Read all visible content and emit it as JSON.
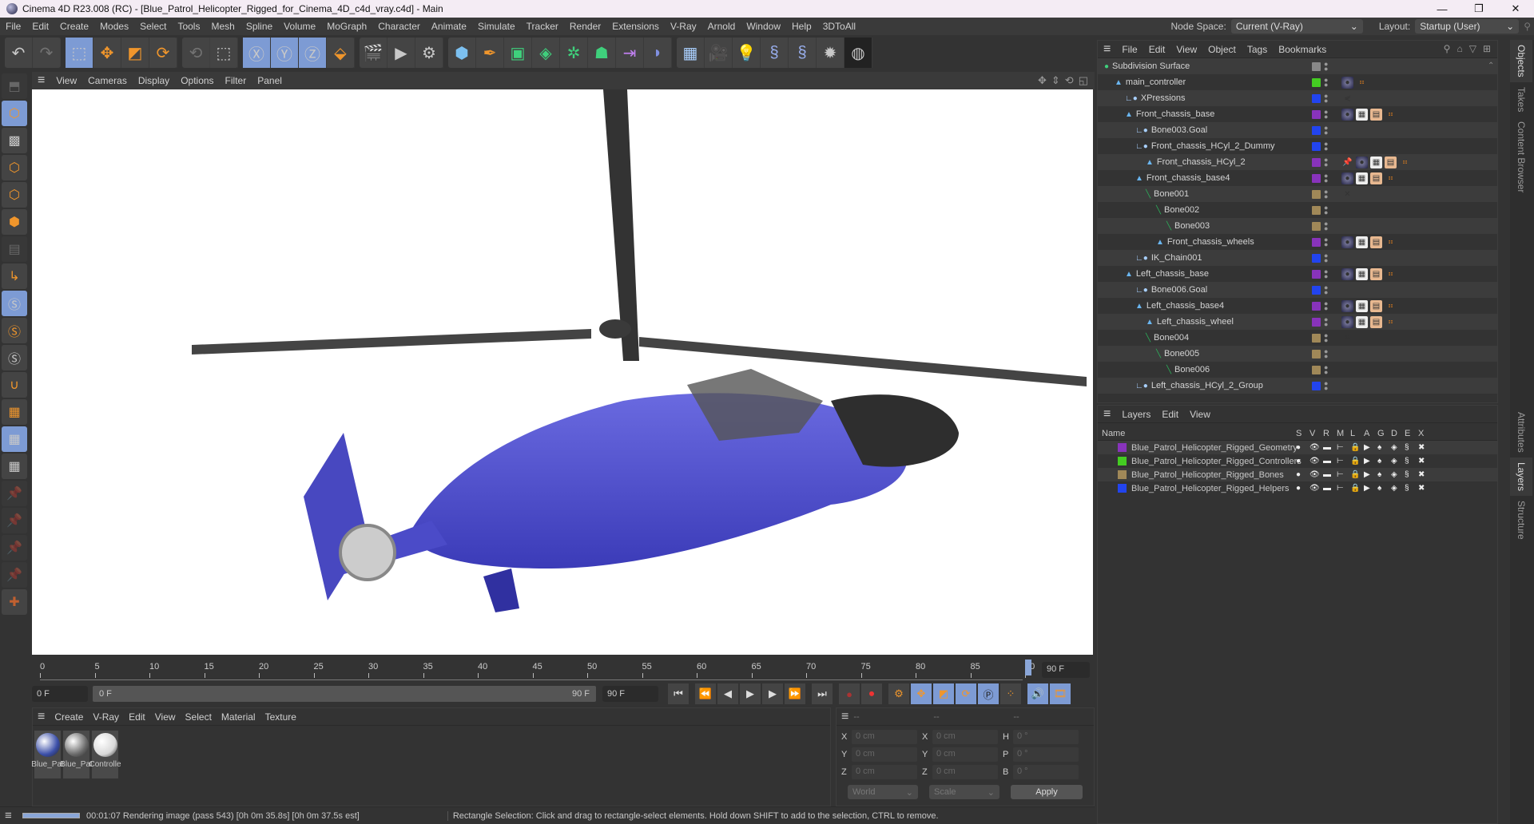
{
  "window": {
    "title": "Cinema 4D R23.008 (RC) - [Blue_Patrol_Helicopter_Rigged_for_Cinema_4D_c4d_vray.c4d] - Main",
    "controls": [
      "minimize",
      "restore",
      "close"
    ]
  },
  "menubar": {
    "items": [
      "File",
      "Edit",
      "Create",
      "Modes",
      "Select",
      "Tools",
      "Mesh",
      "Spline",
      "Volume",
      "MoGraph",
      "Character",
      "Animate",
      "Simulate",
      "Tracker",
      "Render",
      "Extensions",
      "V-Ray",
      "Arnold",
      "Window",
      "Help",
      "3DToAll"
    ],
    "node_space_label": "Node Space:",
    "node_space_value": "Current (V-Ray)",
    "layout_label": "Layout:",
    "layout_value": "Startup (User)"
  },
  "toolbar": {
    "groups": [
      [
        "undo-icon",
        "redo-icon"
      ],
      [
        "live-selection-icon",
        "move-icon",
        "scale-icon",
        "rotate-icon"
      ],
      [
        "psr-icon",
        "rect-selection-icon"
      ],
      [
        "x-axis-icon",
        "y-axis-icon",
        "z-axis-icon",
        "coord-system-icon"
      ],
      [
        "render-view-icon",
        "render-icon",
        "render-settings-icon"
      ],
      [
        "cube-icon",
        "pen-icon",
        "subdivision-icon",
        "extrude-icon",
        "cloner-icon",
        "voronoi-icon",
        "symmetry-icon",
        "deformer-icon"
      ],
      [
        "floor-icon",
        "camera-icon",
        "light-icon",
        "python-icon",
        "python2-icon",
        "gear-burst-icon",
        "sphere-wire-icon"
      ]
    ]
  },
  "viewport": {
    "menu": [
      "View",
      "Cameras",
      "Display",
      "Options",
      "Filter",
      "Panel"
    ]
  },
  "timeline": {
    "ticks": [
      "0",
      "5",
      "10",
      "15",
      "20",
      "25",
      "30",
      "35",
      "40",
      "45",
      "50",
      "55",
      "60",
      "65",
      "70",
      "75",
      "80",
      "85",
      "90"
    ],
    "end_frame": "90 F",
    "current_frame": "0 F",
    "range_start": "0 F",
    "range_end": "90 F",
    "max_frame": "90 F"
  },
  "material_panel": {
    "menu": [
      "Create",
      "V-Ray",
      "Edit",
      "View",
      "Select",
      "Material",
      "Texture"
    ],
    "materials": [
      {
        "name": "Blue_Pat",
        "color": "#3a4ea8"
      },
      {
        "name": "Blue_Pat",
        "color": "#6a6a6a"
      },
      {
        "name": "Controlle",
        "color": "#d8d8d8"
      }
    ]
  },
  "coordinates": {
    "headers": [
      "--",
      "--",
      "--"
    ],
    "rows": [
      {
        "a": "X",
        "av": "0 cm",
        "b": "X",
        "bv": "0 cm",
        "c": "H",
        "cv": "0 °"
      },
      {
        "a": "Y",
        "av": "0 cm",
        "b": "Y",
        "bv": "0 cm",
        "c": "P",
        "cv": "0 °"
      },
      {
        "a": "Z",
        "av": "0 cm",
        "b": "Z",
        "bv": "0 cm",
        "c": "B",
        "cv": "0 °"
      }
    ],
    "mode": "World",
    "transform": "Scale",
    "apply": "Apply"
  },
  "status": {
    "render": "00:01:07 Rendering image (pass 543) [0h  0m 35.8s] [0h  0m 37.5s est]",
    "progress": 1.0,
    "hint": "Rectangle Selection: Click and drag to rectangle-select elements. Hold down SHIFT to add to the selection, CTRL to remove."
  },
  "objects": {
    "menu": [
      "File",
      "Edit",
      "View",
      "Object",
      "Tags",
      "Bookmarks"
    ],
    "rows": [
      {
        "name": "Subdivision Surface",
        "depth": 0,
        "type": "subdiv",
        "color": "#888888",
        "tags": []
      },
      {
        "name": "main_controller",
        "depth": 1,
        "type": "null",
        "color": "#44cc22",
        "tags": [
          "material",
          "vray"
        ]
      },
      {
        "name": "XPressions",
        "depth": 2,
        "type": "helper",
        "color": "#2244ee",
        "tags": [
          "xpresso"
        ]
      },
      {
        "name": "Front_chassis_base",
        "depth": 2,
        "type": "null",
        "color": "#8833bb",
        "tags": [
          "material",
          "uv",
          "texture",
          "vray"
        ]
      },
      {
        "name": "Bone003.Goal",
        "depth": 3,
        "type": "helper",
        "color": "#2244ee",
        "tags": []
      },
      {
        "name": "Front_chassis_HCyl_2_Dummy",
        "depth": 3,
        "type": "helper",
        "color": "#2244ee",
        "tags": []
      },
      {
        "name": "Front_chassis_HCyl_2",
        "depth": 4,
        "type": "null",
        "color": "#8833bb",
        "tags": [
          "constraint",
          "material",
          "uv",
          "texture",
          "vray"
        ]
      },
      {
        "name": "Front_chassis_base4",
        "depth": 3,
        "type": "null",
        "color": "#8833bb",
        "tags": [
          "material",
          "uv",
          "texture",
          "vray"
        ]
      },
      {
        "name": "Bone001",
        "depth": 4,
        "type": "bone",
        "color": "#a08858",
        "tags": [
          "ik"
        ]
      },
      {
        "name": "Bone002",
        "depth": 5,
        "type": "bone",
        "color": "#a08858",
        "tags": []
      },
      {
        "name": "Bone003",
        "depth": 6,
        "type": "bone",
        "color": "#a08858",
        "tags": []
      },
      {
        "name": "Front_chassis_wheels",
        "depth": 5,
        "type": "null",
        "color": "#8833bb",
        "tags": [
          "material",
          "uv",
          "texture",
          "vray"
        ]
      },
      {
        "name": "IK_Chain001",
        "depth": 3,
        "type": "helper",
        "color": "#2244ee",
        "tags": []
      },
      {
        "name": "Left_chassis_base",
        "depth": 2,
        "type": "null",
        "color": "#8833bb",
        "tags": [
          "material",
          "uv",
          "texture",
          "vray"
        ]
      },
      {
        "name": "Bone006.Goal",
        "depth": 3,
        "type": "helper",
        "color": "#2244ee",
        "tags": []
      },
      {
        "name": "Left_chassis_base4",
        "depth": 3,
        "type": "null",
        "color": "#8833bb",
        "tags": [
          "material",
          "uv",
          "texture",
          "vray"
        ]
      },
      {
        "name": "Left_chassis_wheel",
        "depth": 4,
        "type": "null",
        "color": "#8833bb",
        "tags": [
          "material",
          "uv",
          "texture",
          "vray"
        ]
      },
      {
        "name": "Bone004",
        "depth": 4,
        "type": "bone",
        "color": "#a08858",
        "tags": [
          "ik"
        ]
      },
      {
        "name": "Bone005",
        "depth": 5,
        "type": "bone",
        "color": "#a08858",
        "tags": []
      },
      {
        "name": "Bone006",
        "depth": 6,
        "type": "bone",
        "color": "#a08858",
        "tags": []
      },
      {
        "name": "Left_chassis_HCyl_2_Group",
        "depth": 3,
        "type": "helper",
        "color": "#2244ee",
        "tags": []
      }
    ]
  },
  "layers": {
    "menu": [
      "Layers",
      "Edit",
      "View"
    ],
    "columns": [
      "Name",
      "S",
      "V",
      "R",
      "M",
      "L",
      "A",
      "G",
      "D",
      "E",
      "X"
    ],
    "rows": [
      {
        "name": "Blue_Patrol_Helicopter_Rigged_Geometry",
        "color": "#8833bb"
      },
      {
        "name": "Blue_Patrol_Helicopter_Rigged_Controllers",
        "color": "#44cc22"
      },
      {
        "name": "Blue_Patrol_Helicopter_Rigged_Bones",
        "color": "#a08858"
      },
      {
        "name": "Blue_Patrol_Helicopter_Rigged_Helpers",
        "color": "#2244ee"
      }
    ]
  },
  "side_tabs": {
    "top": [
      "Objects",
      "Takes",
      "Content Browser"
    ],
    "bottom": [
      "Attributes",
      "Layers",
      "Structure"
    ]
  }
}
